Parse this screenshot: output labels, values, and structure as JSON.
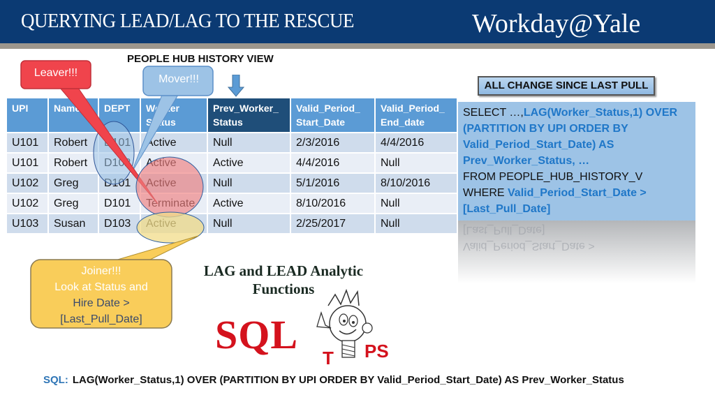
{
  "header": {
    "title": "QUERYING LEAD/LAG TO THE RESCUE",
    "brand": "Workday@Yale"
  },
  "view_title": "PEOPLE HUB HISTORY VIEW",
  "table": {
    "headers": [
      [
        "UPI",
        ""
      ],
      [
        "Name",
        ""
      ],
      [
        "DEPT",
        ""
      ],
      [
        "Worker",
        "Status"
      ],
      [
        "Prev_Worker_",
        "Status"
      ],
      [
        "Valid_Period_",
        "Start_Date"
      ],
      [
        "Valid_Period_",
        "End_date"
      ]
    ],
    "highlighted_column": "Prev_Worker_Status",
    "rows": [
      [
        "U101",
        "Robert",
        "D101",
        "Active",
        "Null",
        "2/3/2016",
        "4/4/2016"
      ],
      [
        "U101",
        "Robert",
        "D102",
        "Active",
        "Active",
        "4/4/2016",
        "Null"
      ],
      [
        "U102",
        "Greg",
        "D101",
        "Active",
        "Null",
        "5/1/2016",
        "8/10/2016"
      ],
      [
        "U102",
        "Greg",
        "D101",
        "Terminate",
        "Active",
        "8/10/2016",
        "Null"
      ],
      [
        "U103",
        "Susan",
        "D103",
        "Active",
        "Null",
        "2/25/2017",
        "Null"
      ]
    ]
  },
  "callouts": {
    "leaver": "Leaver!!!",
    "mover": "Mover!!!",
    "joiner": {
      "line1": "Joiner!!!",
      "line2": "Look at Status and",
      "line3": "Hire Date >",
      "line4": "[Last_Pull_Date]"
    }
  },
  "change_button": "ALL CHANGE SINCE LAST PULL",
  "sql_box": {
    "l1a": "SELECT …,",
    "l1b": "LAG(Worker_Status,1) OVER",
    "l2": "(PARTITION BY UPI ORDER BY",
    "l3": "Valid_Period_Start_Date) AS",
    "l4": "Prev_Worker_Status, …",
    "l5": "FROM PEOPLE_HUB_HISTORY_V",
    "l6a": "WHERE ",
    "l6b": "Valid_Period_Start_Date >",
    "l7": "[Last_Pull_Date]"
  },
  "graphic": {
    "title_line1": "LAG and LEAD Analytic",
    "title_line2": "Functions",
    "sql_word": "SQL",
    "tips_t": "T",
    "tips_ps": "PS"
  },
  "footer": {
    "label": "SQL:",
    "text": "LAG(Worker_Status,1) OVER (PARTITION BY UPI ORDER BY Valid_Period_Start_Date) AS Prev_Worker_Status"
  },
  "colors": {
    "header_bg": "#0b3a73",
    "table_header": "#5b9bd5",
    "table_header_highlight": "#1f4e79",
    "sql_keyword": "#1f77c8",
    "leaver": "#f0444c",
    "mover": "#9dc3e6",
    "joiner": "#f9cd5a"
  }
}
